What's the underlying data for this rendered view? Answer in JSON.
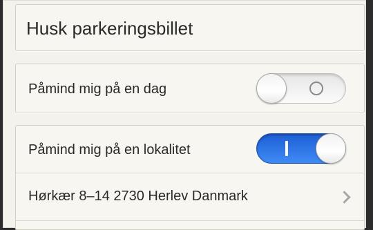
{
  "title": "Husk parkeringsbillet",
  "reminders": {
    "day": {
      "label": "Påmind mig på en dag",
      "enabled": false
    },
    "location": {
      "label": "Påmind mig på en lokalitet",
      "enabled": true,
      "address": "Hørkær 8–14 2730 Herlev Danmark"
    }
  },
  "colors": {
    "accent": "#2f78ea",
    "background": "#f3f2ec"
  },
  "icons": {
    "switch_off": "circle-glyph",
    "switch_on": "bar-glyph",
    "disclosure": "chevron-right-icon"
  }
}
